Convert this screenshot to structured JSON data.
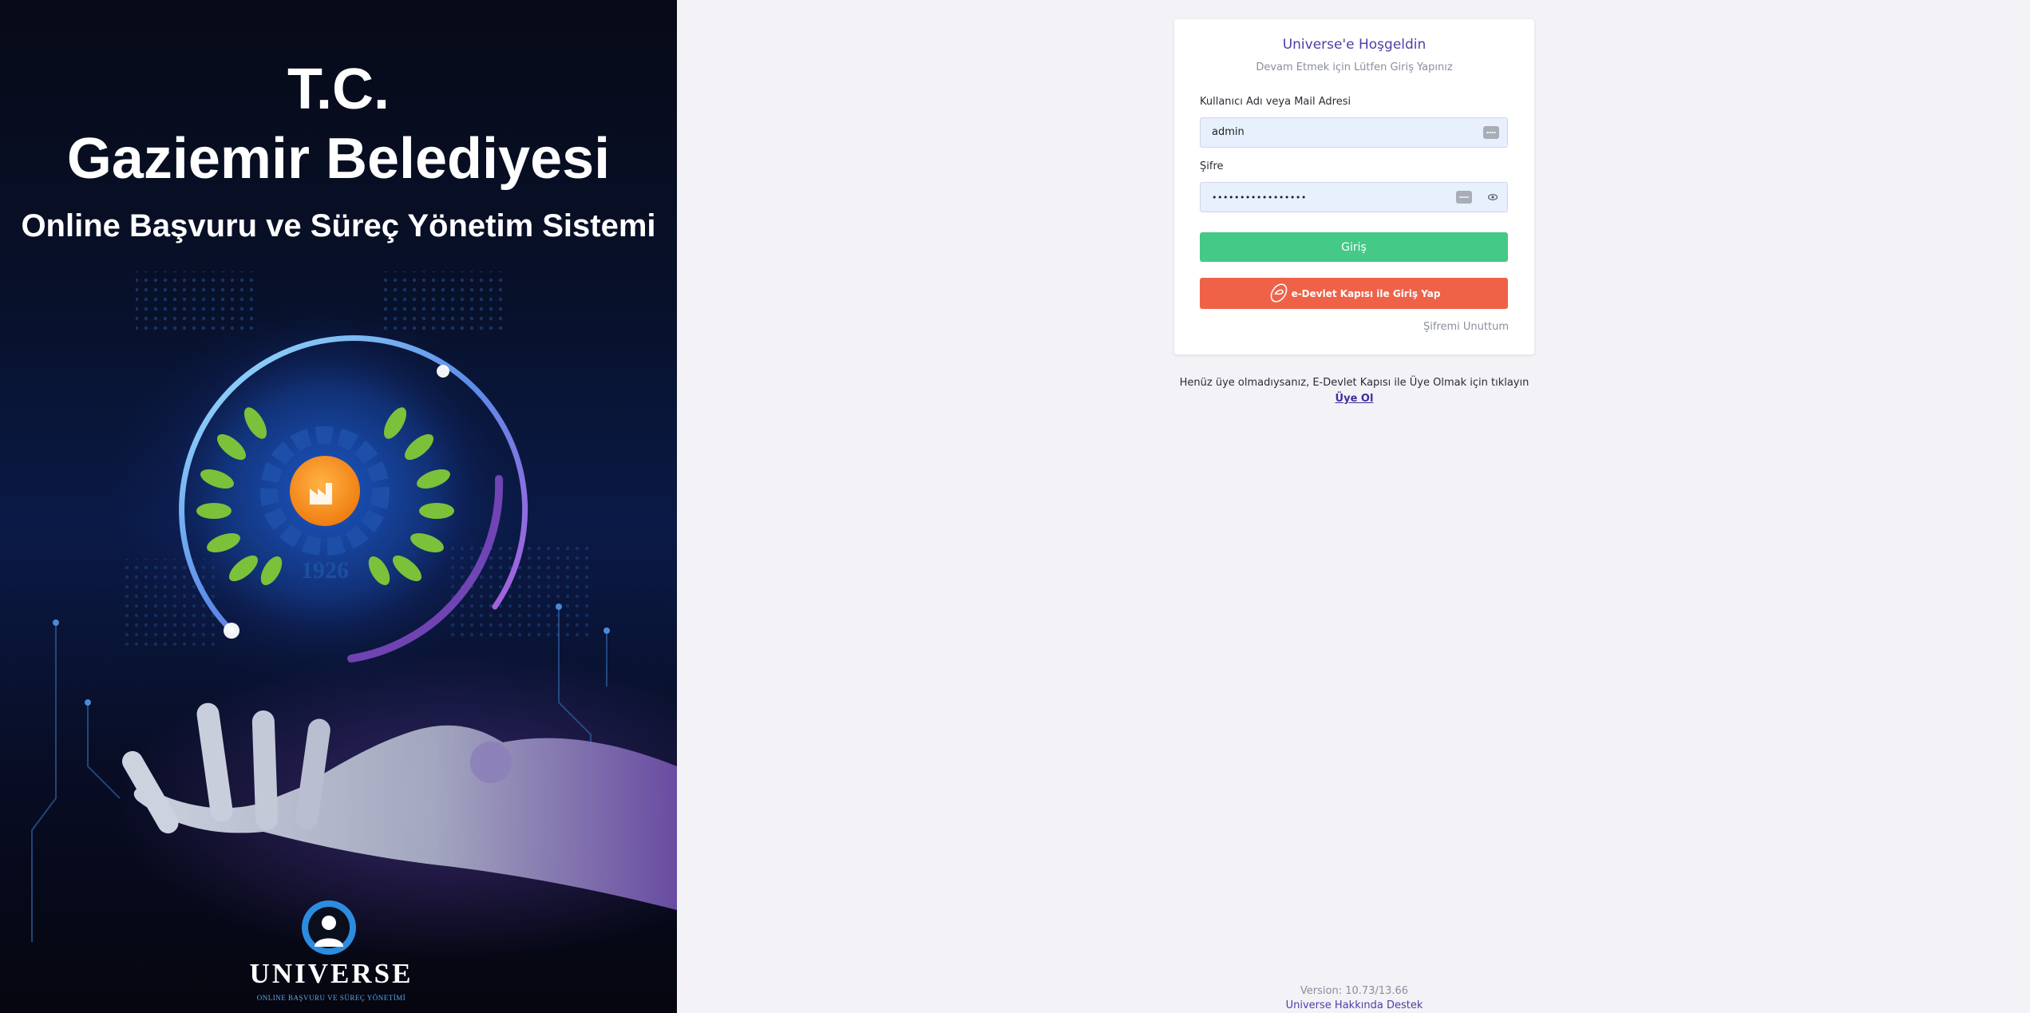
{
  "hero": {
    "title_line1": "T.C.",
    "title_line2": "Gaziemir Belediyesi",
    "subtitle": "Online Başvuru ve Süreç Yönetim Sistemi",
    "emblem_year": "1926",
    "brand_name": "UNIVERSE",
    "brand_tagline": "ONLINE BAŞVURU VE SÜREÇ YÖNETİMİ"
  },
  "login": {
    "title": "Universe'e Hoşgeldin",
    "subtitle": "Devam Etmek için Lütfen Giriş Yapınız",
    "username_label": "Kullanıcı Adı veya Mail Adresi",
    "username_value": "admin",
    "password_label": "Şifre",
    "password_masked": "•••••••••••••••••",
    "login_button": "Giriş",
    "edevlet_button": "e-Devlet Kapısı ile Giriş Yap",
    "forgot_password": "Şifremi Unuttum"
  },
  "signup": {
    "text": "Henüz üye olmadıysanız, E-Devlet Kapısı ile Üye Olmak için tıklayın",
    "link": "Üye Ol"
  },
  "footer": {
    "version": "Version: 10.73/13.66",
    "about_link": "Universe Hakkında",
    "support_link": "Destek"
  },
  "colors": {
    "accent": "#4b3fa6",
    "login_button": "#45c987",
    "edevlet_button": "#ef6248",
    "input_bg": "#e8f0fe",
    "page_bg": "#f3f2f7"
  },
  "icons": {
    "username_autofill": "key-dots-icon",
    "password_autofill": "key-dots-icon",
    "password_toggle": "eye-icon",
    "edevlet_logo": "edevlet-logo-icon"
  }
}
